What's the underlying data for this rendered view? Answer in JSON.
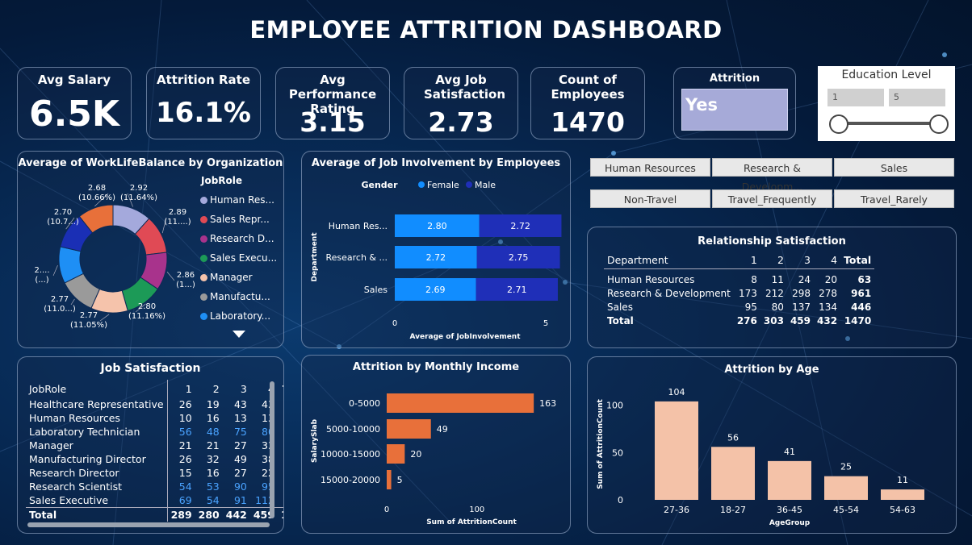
{
  "header": {
    "title": "EMPLOYEE ATTRITION DASHBOARD"
  },
  "kpis": [
    {
      "label": "Avg Salary",
      "value": "6.5K"
    },
    {
      "label": "Attrition Rate",
      "value": "16.1%"
    },
    {
      "label": "Avg Performance Rating",
      "value": "3.15"
    },
    {
      "label": "Avg Job Satisfaction",
      "value": "2.73"
    },
    {
      "label": "Count of Employees",
      "value": "1470"
    }
  ],
  "attrition_slicer": {
    "label": "Attrition",
    "value": "Yes"
  },
  "education_slicer": {
    "label": "Education Level",
    "min": "1",
    "max": "5"
  },
  "department_buttons": [
    "Human Resources",
    "Research & Developm...",
    "Sales"
  ],
  "travel_buttons": [
    "Non-Travel",
    "Travel_Frequently",
    "Travel_Rarely"
  ],
  "colors": {
    "female": "#118dff",
    "male": "#1f2fb8",
    "income_bar": "#e8703a",
    "age_bar": "#f4c2a8"
  },
  "donut": {
    "title": "Average of WorkLifeBalance by Organization",
    "legend_title": "JobRole",
    "legend": [
      {
        "name": "Human Res...",
        "color": "#a4a9dc"
      },
      {
        "name": "Sales Repr...",
        "color": "#e04a55"
      },
      {
        "name": "Research D...",
        "color": "#a8338c"
      },
      {
        "name": "Sales Execu...",
        "color": "#1c9a57"
      },
      {
        "name": "Manager",
        "color": "#f5c3ab"
      },
      {
        "name": "Manufactu...",
        "color": "#9a9a9a"
      },
      {
        "name": "Laboratory...",
        "color": "#1e8ff5"
      }
    ],
    "slice_labels": [
      "2.92\n(11.64%)",
      "2.89\n(11....)",
      "2.86\n(1...)",
      "2.80\n(11.16%)",
      "2.77\n(11.05%)",
      "2.77\n(11.0...)",
      "2....\n(...)",
      "2.70\n(10.7...)",
      "2.68\n(10.66%)"
    ]
  },
  "involvement": {
    "title": "Average of Job Involvement by Employees",
    "legend_title": "Gender",
    "legend": [
      "Female",
      "Male"
    ],
    "ylabel": "Department",
    "xlabel": "Average of JobInvolvement",
    "xticks": [
      "0",
      "5"
    ]
  },
  "relationship": {
    "title": "Relationship Satisfaction",
    "header": [
      "Department",
      "1",
      "2",
      "3",
      "4",
      "Total"
    ],
    "rows": [
      [
        "Human Resources",
        "8",
        "11",
        "24",
        "20",
        "63"
      ],
      [
        "Research & Development",
        "173",
        "212",
        "298",
        "278",
        "961"
      ],
      [
        "Sales",
        "95",
        "80",
        "137",
        "134",
        "446"
      ]
    ],
    "total": [
      "Total",
      "276",
      "303",
      "459",
      "432",
      "1470"
    ]
  },
  "job_satisfaction": {
    "title": "Job Satisfaction",
    "header": [
      "JobRole",
      "1",
      "2",
      "3",
      "4",
      "To"
    ],
    "rows": [
      [
        "Healthcare Representative",
        "26",
        "19",
        "43",
        "43",
        "1"
      ],
      [
        "Human Resources",
        "10",
        "16",
        "13",
        "13",
        ""
      ],
      [
        "Laboratory Technician",
        "56",
        "48",
        "75",
        "80",
        "2"
      ],
      [
        "Manager",
        "21",
        "21",
        "27",
        "33",
        "1"
      ],
      [
        "Manufacturing Director",
        "26",
        "32",
        "49",
        "38",
        "1"
      ],
      [
        "Research Director",
        "15",
        "16",
        "27",
        "22",
        ""
      ],
      [
        "Research Scientist",
        "54",
        "53",
        "90",
        "95",
        "2"
      ],
      [
        "Sales Executive",
        "69",
        "54",
        "91",
        "112",
        "3"
      ]
    ],
    "total": [
      "Total",
      "289",
      "280",
      "442",
      "459",
      "14"
    ]
  },
  "income": {
    "title": "Attrition by Monthly Income",
    "ylabel": "SalarySlab",
    "xlabel": "Sum of AttritionCount",
    "xticks": [
      "0",
      "100"
    ]
  },
  "age": {
    "title": "Attrition by Age",
    "ylabel": "Sum of AttritionCount",
    "xlabel": "AgeGroup",
    "yticks": [
      "0",
      "50",
      "100"
    ]
  },
  "chart_data": [
    {
      "type": "pie",
      "title": "Average of WorkLifeBalance by Organization",
      "categories": [
        "Human Resources",
        "Sales Representative",
        "Research Director",
        "Sales Executive",
        "Manager",
        "Manufacturing Director",
        "Laboratory Technician",
        "Research Scientist",
        "Healthcare Representative"
      ],
      "values": [
        2.92,
        2.89,
        2.86,
        2.8,
        2.77,
        2.77,
        2.76,
        2.7,
        2.68
      ],
      "colors": [
        "#a4a9dc",
        "#e04a55",
        "#a8338c",
        "#1c9a57",
        "#f5c3ab",
        "#9a9a9a",
        "#1e8ff5",
        "#1a2fb5",
        "#e8703a"
      ]
    },
    {
      "type": "bar",
      "title": "Average of Job Involvement by Employees",
      "categories": [
        "Human Res...",
        "Research & ...",
        "Sales"
      ],
      "series": [
        {
          "name": "Female",
          "values": [
            2.8,
            2.72,
            2.69
          ]
        },
        {
          "name": "Male",
          "values": [
            2.72,
            2.75,
            2.71
          ]
        }
      ],
      "xlim": [
        0,
        5
      ]
    },
    {
      "type": "bar",
      "title": "Attrition by Monthly Income",
      "categories": [
        "0-5000",
        "5000-10000",
        "10000-15000",
        "15000-20000"
      ],
      "values": [
        163,
        49,
        20,
        5
      ],
      "xlim": [
        0,
        170
      ]
    },
    {
      "type": "bar",
      "title": "Attrition by Age",
      "categories": [
        "27-36",
        "18-27",
        "36-45",
        "45-54",
        "54-63"
      ],
      "values": [
        104,
        56,
        41,
        25,
        11
      ],
      "ylim": [
        0,
        115
      ]
    }
  ]
}
